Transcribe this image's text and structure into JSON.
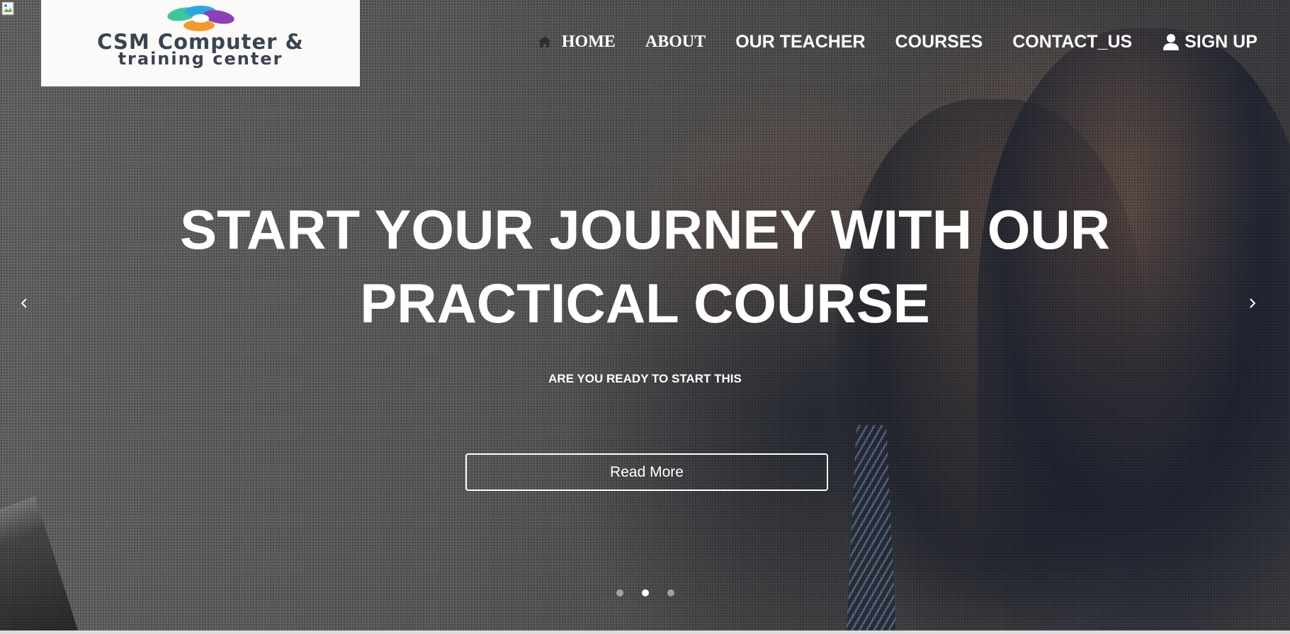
{
  "logo": {
    "line1": "CSM Computer &",
    "line2": "training center",
    "colors": [
      "#3ec6a0",
      "#2aa8e0",
      "#8e3fb8",
      "#f29b2a"
    ]
  },
  "nav": {
    "home_icon": "home-icon",
    "items": [
      {
        "label": "HOME"
      },
      {
        "label": "ABOUT"
      },
      {
        "label": "OUR TEACHER"
      },
      {
        "label": "COURSES"
      },
      {
        "label": "CONTACT_US"
      }
    ],
    "signup": {
      "icon": "user-icon",
      "label": "SIGN UP"
    }
  },
  "hero": {
    "title": "START YOUR JOURNEY WITH OUR PRACTICAL COURSE",
    "subtitle": "ARE YOU READY TO START THIS",
    "button_label": "Read More",
    "prev_icon": "chevron-left-icon",
    "next_icon": "chevron-right-icon",
    "slides_total": 3,
    "active_slide": 2
  },
  "colors": {
    "text": "#ffffff",
    "logo_text": "#3a4350",
    "logo_bg": "#fbfaf9"
  }
}
